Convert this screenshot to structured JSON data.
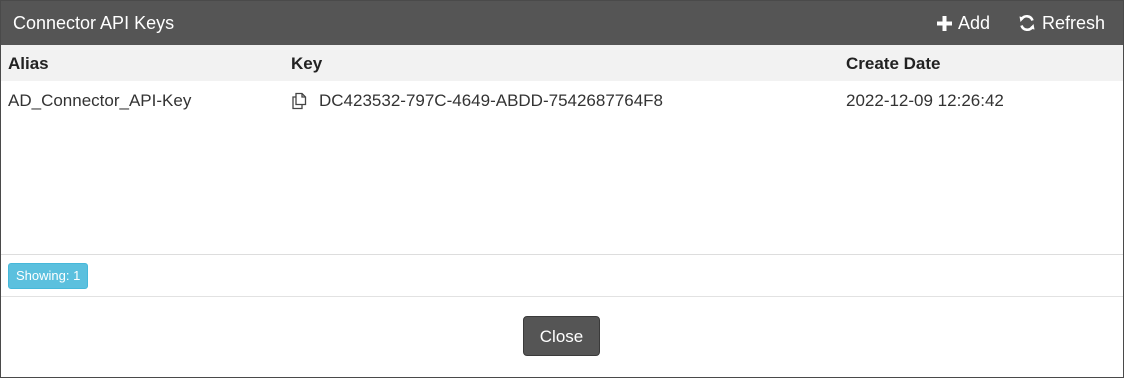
{
  "dialog": {
    "title": "Connector API Keys",
    "actions": {
      "add_label": "Add",
      "add_icon": "plus-icon",
      "refresh_label": "Refresh",
      "refresh_icon": "refresh-icon"
    }
  },
  "table": {
    "columns": [
      "Alias",
      "Key",
      "Create Date"
    ],
    "rows": [
      {
        "alias": "AD_Connector_API-Key",
        "key": "DC423532-797C-4649-ABDD-7542687764F8",
        "key_icon": "copy-icon",
        "create_date": "2022-12-09 12:26:42"
      }
    ]
  },
  "status": {
    "showing_label": "Showing: 1"
  },
  "footer": {
    "close_label": "Close"
  },
  "colors": {
    "titlebar": "#555555",
    "badge": "#5bc0de",
    "close_button": "#555555"
  }
}
